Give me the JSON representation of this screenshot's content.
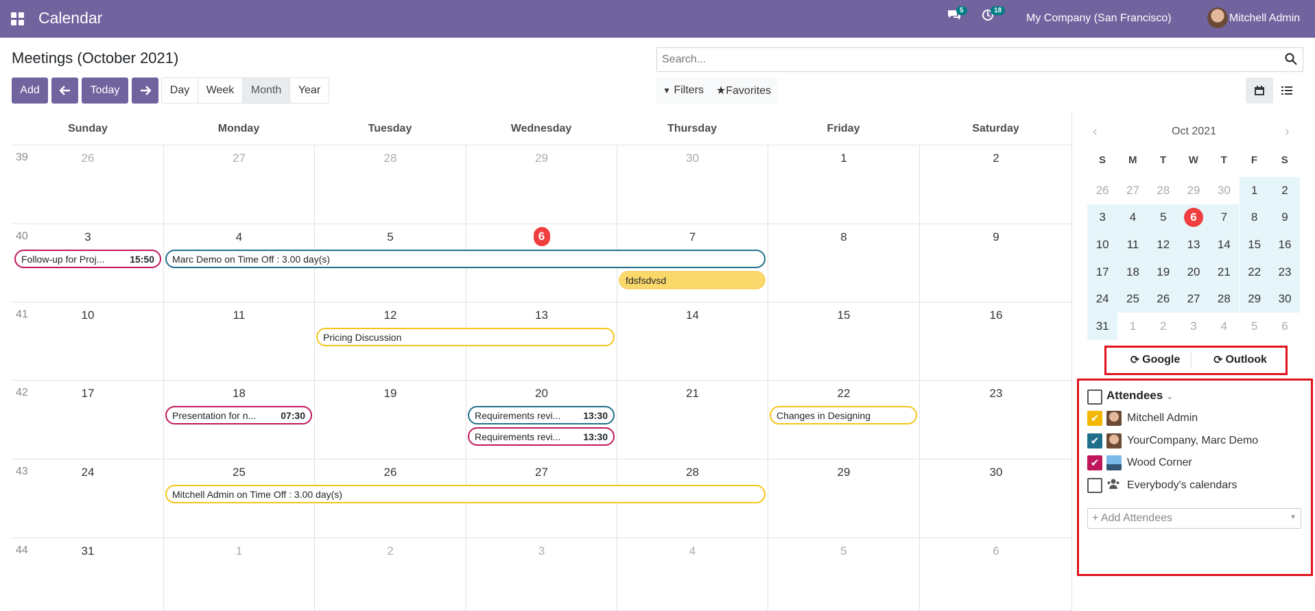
{
  "app": {
    "title": "Calendar",
    "company": "My Company (San Francisco)",
    "user": "Mitchell Admin",
    "messages_count": "5",
    "activities_count": "18"
  },
  "page": {
    "title": "Meetings (October 2021)"
  },
  "toolbar": {
    "add": "Add",
    "prev": "←",
    "today": "Today",
    "next": "→",
    "views": [
      "Day",
      "Week",
      "Month",
      "Year"
    ],
    "active_view": "Month",
    "filters": "Filters",
    "favorites": "Favorites"
  },
  "search": {
    "placeholder": "Search..."
  },
  "calendar": {
    "weekdays": [
      "Sunday",
      "Monday",
      "Tuesday",
      "Wednesday",
      "Thursday",
      "Friday",
      "Saturday"
    ],
    "weeks": [
      {
        "num": "39",
        "days": [
          "26",
          "27",
          "28",
          "29",
          "30",
          "1",
          "2"
        ],
        "other": [
          true,
          true,
          true,
          true,
          true,
          false,
          false
        ]
      },
      {
        "num": "40",
        "days": [
          "3",
          "4",
          "5",
          "6",
          "7",
          "8",
          "9"
        ],
        "other": [
          false,
          false,
          false,
          false,
          false,
          false,
          false
        ]
      },
      {
        "num": "41",
        "days": [
          "10",
          "11",
          "12",
          "13",
          "14",
          "15",
          "16"
        ],
        "other": [
          false,
          false,
          false,
          false,
          false,
          false,
          false
        ]
      },
      {
        "num": "42",
        "days": [
          "17",
          "18",
          "19",
          "20",
          "21",
          "22",
          "23"
        ],
        "other": [
          false,
          false,
          false,
          false,
          false,
          false,
          false
        ]
      },
      {
        "num": "43",
        "days": [
          "24",
          "25",
          "26",
          "27",
          "28",
          "29",
          "30"
        ],
        "other": [
          false,
          false,
          false,
          false,
          false,
          false,
          false
        ]
      },
      {
        "num": "44",
        "days": [
          "31",
          "1",
          "2",
          "3",
          "4",
          "5",
          "6"
        ],
        "other": [
          false,
          true,
          true,
          true,
          true,
          true,
          true
        ]
      }
    ],
    "today": "6",
    "events": [
      {
        "title": "Follow-up for Proj...",
        "time": "15:50",
        "color": "crimson"
      },
      {
        "title": "Marc Demo on Time Off : 3.00 day(s)",
        "time": "",
        "color": "blue"
      },
      {
        "title": "fdsfsdvsd",
        "time": "",
        "color": "filled"
      },
      {
        "title": "Pricing Discussion",
        "time": "",
        "color": "yellow"
      },
      {
        "title": "Presentation for n...",
        "time": "07:30",
        "color": "crimson"
      },
      {
        "title": "Requirements revi...",
        "time": "13:30",
        "color": "blue"
      },
      {
        "title": "Requirements revi...",
        "time": "13:30",
        "color": "crimson"
      },
      {
        "title": "Changes in Designing",
        "time": "",
        "color": "yellow"
      },
      {
        "title": "Mitchell Admin on Time Off : 3.00 day(s)",
        "time": "",
        "color": "yellow"
      }
    ]
  },
  "minical": {
    "month": "Oct 2021",
    "weekdays": [
      "S",
      "M",
      "T",
      "W",
      "T",
      "F",
      "S"
    ],
    "rows": [
      [
        "26",
        "27",
        "28",
        "29",
        "30",
        "1",
        "2"
      ],
      [
        "3",
        "4",
        "5",
        "6",
        "7",
        "8",
        "9"
      ],
      [
        "10",
        "11",
        "12",
        "13",
        "14",
        "15",
        "16"
      ],
      [
        "17",
        "18",
        "19",
        "20",
        "21",
        "22",
        "23"
      ],
      [
        "24",
        "25",
        "26",
        "27",
        "28",
        "29",
        "30"
      ],
      [
        "31",
        "1",
        "2",
        "3",
        "4",
        "5",
        "6"
      ]
    ]
  },
  "sync": {
    "google": "Google",
    "outlook": "Outlook"
  },
  "attendees": {
    "header": "Attendees",
    "items": [
      {
        "name": "Mitchell Admin",
        "checked": true,
        "color": "#f5b800"
      },
      {
        "name": "YourCompany, Marc Demo",
        "checked": true,
        "color": "#1f6f8b"
      },
      {
        "name": "Wood Corner",
        "checked": true,
        "color": "#c0165c"
      },
      {
        "name": "Everybody's calendars",
        "checked": false,
        "color": ""
      }
    ],
    "add_placeholder": "+ Add Attendees"
  },
  "colors": {
    "brand": "#71639e",
    "today": "#f03e3e",
    "highlight": "#e0121a"
  }
}
